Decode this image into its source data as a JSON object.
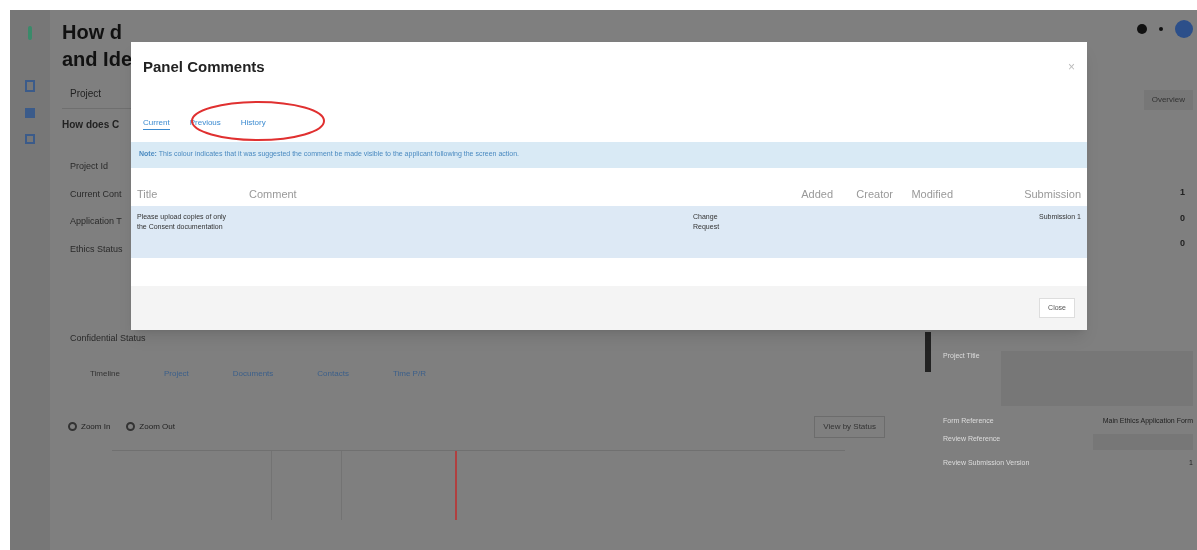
{
  "page": {
    "title_fragments": [
      "How d",
      "and Ide"
    ],
    "project_tab": "Project",
    "subtitle_fragment": "How does C",
    "field_labels": [
      "Project Id",
      "Current Cont",
      "Application T",
      "Ethics Status"
    ],
    "confidential_label": "Confidential Status",
    "lower_tabs": [
      {
        "label": "Timeline",
        "selected": true
      },
      {
        "label": "Project",
        "selected": false
      },
      {
        "label": "Documents",
        "selected": false
      },
      {
        "label": "Contacts",
        "selected": false
      },
      {
        "label": "Time P/R",
        "selected": false
      }
    ],
    "zoom_buttons": [
      "Zoom In",
      "Zoom Out"
    ],
    "view_button": "View by Status",
    "overview_button": "Overview",
    "counts": [
      "1",
      "0",
      "0"
    ],
    "details": [
      {
        "label": "Form Reference",
        "value": "Main Ethics Application Form"
      },
      {
        "label": "Review Reference"
      },
      {
        "label": "Review Submission Version",
        "value": "1"
      }
    ],
    "project_title_label": "Project Title"
  },
  "dialog": {
    "title": "Panel Comments",
    "close_icon": "×",
    "tabs": [
      {
        "label": "Current",
        "selected": true
      },
      {
        "label": "Previous",
        "selected": false
      },
      {
        "label": "History",
        "selected": false
      }
    ],
    "note": "**Note:** This colour indicates that it was suggested the comment be made visible to the applicant following the screen action.",
    "columns": [
      "Title",
      "Comment",
      "Added",
      "Creator",
      "Modified",
      "Submission"
    ],
    "rows": [
      {
        "title": "Please upload copies of only the Consent documentation",
        "type": "Change Request",
        "submission": "Submission 1",
        "highlighted": true
      }
    ],
    "footer_button": "Close"
  }
}
